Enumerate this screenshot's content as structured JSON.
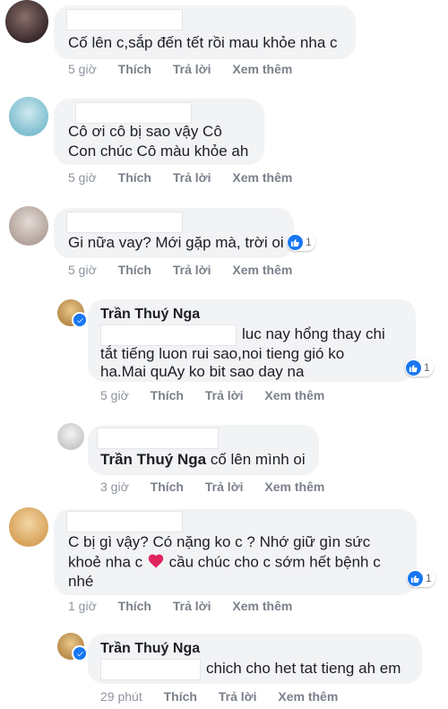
{
  "comments": [
    {
      "text_lines": [
        "Cố lên c,sắp đến tết rồi mau khỏe nha c"
      ],
      "time": "5 giờ"
    },
    {
      "text_lines": [
        "Cô ơi cô bị sao vậy Cô",
        "Con chúc Cô màu khỏe ah"
      ],
      "time": "5 giờ"
    },
    {
      "text_lines": [
        "Gi nữa vay? Mới gặp mà, trời oi"
      ],
      "time": "5 giờ",
      "likes": "1"
    },
    {
      "author": "Trần Thuý Nga",
      "text_lines": [
        "luc nay hổng thay chi",
        "tắt tiếng luon rui sao,noi tieng gió ko",
        "ha.Mai quAy ko bit sao day na"
      ],
      "time": "5 giờ",
      "likes": "1"
    },
    {
      "author": "Trần Thuý Nga",
      "text_lines": [
        "cố lên mình oi"
      ],
      "time": "3 giờ"
    },
    {
      "text_lines": [
        "C bị gì vậy? Có nặng ko c ? Nhớ giữ gìn sức",
        "khoẻ nha c",
        "cầu chúc cho c sớm hết bệnh c",
        "nhé"
      ],
      "time": "1 giờ",
      "likes": "1"
    },
    {
      "author": "Trần Thuý Nga",
      "text_lines": [
        "chich cho het tat tieng ah em"
      ],
      "time": "29 phút"
    }
  ],
  "actions": {
    "like": "Thích",
    "reply": "Trả lời",
    "more": "Xem thêm"
  },
  "icons": {
    "like": "thumbs-up-icon",
    "heart": "heart-icon",
    "verified": "verified-icon"
  },
  "colors": {
    "bubble": "#f2f3f5",
    "like_blue": "#1877f2",
    "heart": "#e0245e",
    "meta": "#8d949e"
  }
}
